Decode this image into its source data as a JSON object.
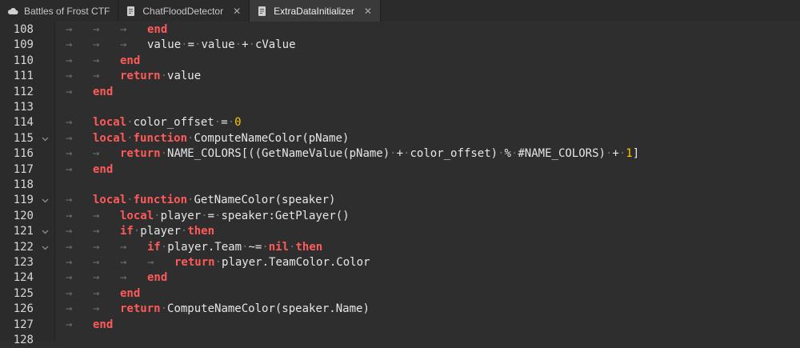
{
  "tabs": [
    {
      "label": "Battles of Frost CTF",
      "icon": "cloud-icon",
      "active": false,
      "closable": false
    },
    {
      "label": "ChatFloodDetector",
      "icon": "script-icon",
      "active": false,
      "closable": true
    },
    {
      "label": "ExtraDataInitializer",
      "icon": "script-icon",
      "active": true,
      "closable": true
    }
  ],
  "colors": {
    "keyword": "#ff5a5a",
    "number": "#ffc600",
    "text": "#e6e6e6",
    "background": "#2e2e2e"
  },
  "lines": [
    {
      "no": "108",
      "fold": false,
      "indent": 3,
      "tokens": [
        [
          "kw",
          "end"
        ]
      ]
    },
    {
      "no": "109",
      "fold": false,
      "indent": 3,
      "tokens": [
        [
          "t",
          "value"
        ],
        [
          "d",
          " "
        ],
        [
          "t",
          "="
        ],
        [
          "d",
          " "
        ],
        [
          "t",
          "value"
        ],
        [
          "d",
          " "
        ],
        [
          "t",
          "+"
        ],
        [
          "d",
          " "
        ],
        [
          "t",
          "cValue"
        ]
      ]
    },
    {
      "no": "110",
      "fold": false,
      "indent": 2,
      "tokens": [
        [
          "kw",
          "end"
        ]
      ]
    },
    {
      "no": "111",
      "fold": false,
      "indent": 2,
      "tokens": [
        [
          "kw",
          "return"
        ],
        [
          "d",
          " "
        ],
        [
          "t",
          "value"
        ]
      ]
    },
    {
      "no": "112",
      "fold": false,
      "indent": 1,
      "tokens": [
        [
          "kw",
          "end"
        ]
      ]
    },
    {
      "no": "113",
      "fold": false,
      "indent": 0,
      "tokens": []
    },
    {
      "no": "114",
      "fold": false,
      "indent": 1,
      "tokens": [
        [
          "kw",
          "local"
        ],
        [
          "d",
          " "
        ],
        [
          "t",
          "color_offset"
        ],
        [
          "d",
          " "
        ],
        [
          "t",
          "="
        ],
        [
          "d",
          " "
        ],
        [
          "num",
          "0"
        ]
      ]
    },
    {
      "no": "115",
      "fold": true,
      "indent": 1,
      "tokens": [
        [
          "kw",
          "local"
        ],
        [
          "d",
          " "
        ],
        [
          "kw",
          "function"
        ],
        [
          "d",
          " "
        ],
        [
          "t",
          "ComputeNameColor(pName)"
        ]
      ]
    },
    {
      "no": "116",
      "fold": false,
      "indent": 2,
      "tokens": [
        [
          "kw",
          "return"
        ],
        [
          "d",
          " "
        ],
        [
          "t",
          "NAME_COLORS[((GetNameValue(pName)"
        ],
        [
          "d",
          " "
        ],
        [
          "t",
          "+"
        ],
        [
          "d",
          " "
        ],
        [
          "t",
          "color_offset)"
        ],
        [
          "d",
          " "
        ],
        [
          "t",
          "%"
        ],
        [
          "d",
          " "
        ],
        [
          "t",
          "#NAME_COLORS)"
        ],
        [
          "d",
          " "
        ],
        [
          "t",
          "+"
        ],
        [
          "d",
          " "
        ],
        [
          "num",
          "1"
        ],
        [
          "t",
          "]"
        ]
      ]
    },
    {
      "no": "117",
      "fold": false,
      "indent": 1,
      "tokens": [
        [
          "kw",
          "end"
        ]
      ]
    },
    {
      "no": "118",
      "fold": false,
      "indent": 0,
      "tokens": []
    },
    {
      "no": "119",
      "fold": true,
      "indent": 1,
      "tokens": [
        [
          "kw",
          "local"
        ],
        [
          "d",
          " "
        ],
        [
          "kw",
          "function"
        ],
        [
          "d",
          " "
        ],
        [
          "t",
          "GetNameColor(speaker)"
        ]
      ]
    },
    {
      "no": "120",
      "fold": false,
      "indent": 2,
      "tokens": [
        [
          "kw",
          "local"
        ],
        [
          "d",
          " "
        ],
        [
          "t",
          "player"
        ],
        [
          "d",
          " "
        ],
        [
          "t",
          "="
        ],
        [
          "d",
          " "
        ],
        [
          "t",
          "speaker:GetPlayer()"
        ]
      ]
    },
    {
      "no": "121",
      "fold": true,
      "indent": 2,
      "tokens": [
        [
          "kw",
          "if"
        ],
        [
          "d",
          " "
        ],
        [
          "t",
          "player"
        ],
        [
          "d",
          " "
        ],
        [
          "kw",
          "then"
        ]
      ]
    },
    {
      "no": "122",
      "fold": true,
      "indent": 3,
      "tokens": [
        [
          "kw",
          "if"
        ],
        [
          "d",
          " "
        ],
        [
          "t",
          "player.Team"
        ],
        [
          "d",
          " "
        ],
        [
          "t",
          "~="
        ],
        [
          "d",
          " "
        ],
        [
          "kw",
          "nil"
        ],
        [
          "d",
          " "
        ],
        [
          "kw",
          "then"
        ]
      ]
    },
    {
      "no": "123",
      "fold": false,
      "indent": 4,
      "tokens": [
        [
          "kw",
          "return"
        ],
        [
          "d",
          " "
        ],
        [
          "t",
          "player.TeamColor.Color"
        ]
      ]
    },
    {
      "no": "124",
      "fold": false,
      "indent": 3,
      "tokens": [
        [
          "kw",
          "end"
        ]
      ]
    },
    {
      "no": "125",
      "fold": false,
      "indent": 2,
      "tokens": [
        [
          "kw",
          "end"
        ]
      ]
    },
    {
      "no": "126",
      "fold": false,
      "indent": 2,
      "tokens": [
        [
          "kw",
          "return"
        ],
        [
          "d",
          " "
        ],
        [
          "t",
          "ComputeNameColor(speaker.Name)"
        ]
      ]
    },
    {
      "no": "127",
      "fold": false,
      "indent": 1,
      "tokens": [
        [
          "kw",
          "end"
        ]
      ]
    },
    {
      "no": "128",
      "fold": false,
      "indent": 0,
      "tokens": []
    }
  ]
}
